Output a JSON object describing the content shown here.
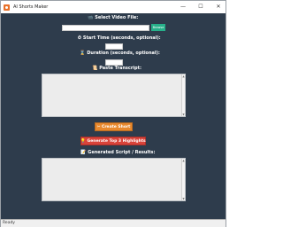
{
  "window": {
    "title": "AI Shorts Maker",
    "controls": {
      "minimize": "—",
      "maximize": "☐",
      "close": "✕"
    }
  },
  "form": {
    "video_label": "Select Video File:",
    "video_icon": "📹",
    "video_value": "",
    "browse_label": "Browse",
    "start_label": "Start Time (seconds, optional):",
    "start_icon": "⏱",
    "start_value": "",
    "duration_label": "Duration (seconds, optional):",
    "duration_icon": "⌛",
    "duration_value": "",
    "transcript_label": "Paste Transcript:",
    "transcript_icon": "📜",
    "transcript_value": "",
    "create_label": "✂ Create Short",
    "generate_label": "💡 Generate Top 3 Highlights",
    "results_label": "Generated Script / Results:",
    "results_icon": "📝",
    "results_value": ""
  },
  "status": {
    "text": "Ready"
  },
  "colors": {
    "background": "#2e3c4c",
    "browse": "#27b08a",
    "create": "#e8892d",
    "generate": "#d9433a"
  }
}
